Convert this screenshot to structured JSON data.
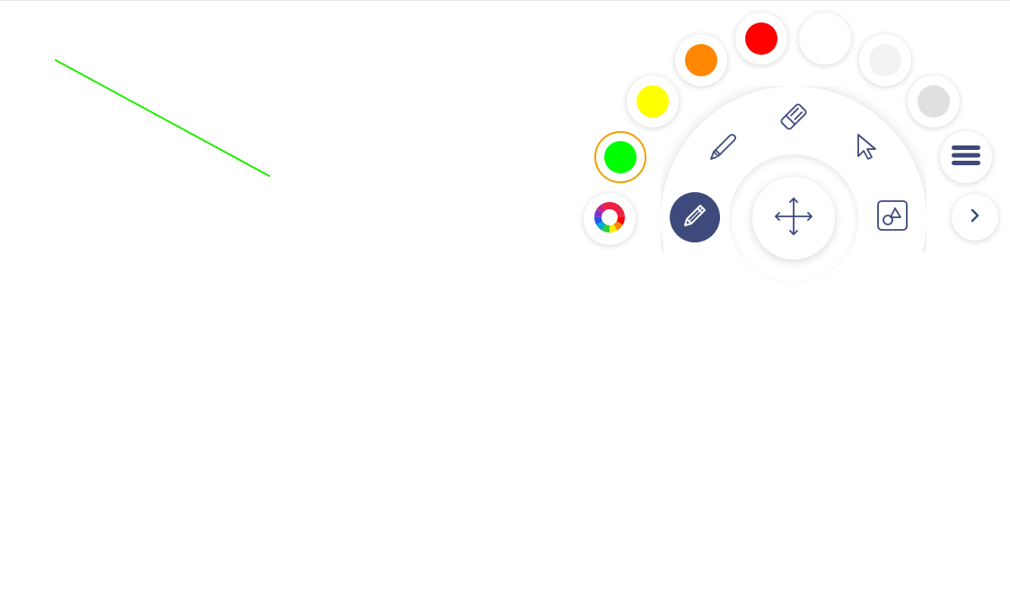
{
  "canvas": {
    "strokes": [
      {
        "color": "#22ee00",
        "points": [
          [
            62,
            67
          ],
          [
            300,
            196
          ]
        ]
      }
    ]
  },
  "toolbar": {
    "accent_color": "#3d4a7b",
    "selected_ring_color": "#f0a000",
    "palette": [
      {
        "name": "color-green",
        "color": "#00ff00",
        "selected": true
      },
      {
        "name": "color-yellow",
        "color": "#ffff00",
        "selected": false
      },
      {
        "name": "color-orange",
        "color": "#ff8800",
        "selected": false
      },
      {
        "name": "color-red",
        "color": "#ff0000",
        "selected": false
      },
      {
        "name": "color-white",
        "color": "#ffffff",
        "selected": false
      },
      {
        "name": "color-light-gray",
        "color": "#f2f2f2",
        "selected": false
      },
      {
        "name": "color-gray",
        "color": "#e0e0e0",
        "selected": false
      }
    ],
    "tools": [
      {
        "name": "pen-tool",
        "icon": "pencil-icon",
        "active": true
      },
      {
        "name": "highlighter-tool",
        "icon": "highlighter-icon",
        "active": false
      },
      {
        "name": "eraser-tool",
        "icon": "eraser-icon",
        "active": false
      },
      {
        "name": "select-tool",
        "icon": "pointer-icon",
        "active": false
      },
      {
        "name": "shapes-tool",
        "icon": "shapes-icon",
        "active": false
      },
      {
        "name": "move-tool",
        "icon": "move-icon",
        "active": false
      }
    ],
    "extra_buttons": [
      {
        "name": "color-wheel-button",
        "icon": "color-wheel-icon"
      },
      {
        "name": "menu-button",
        "icon": "hamburger-icon"
      },
      {
        "name": "expand-button",
        "icon": "chevron-right-icon"
      }
    ]
  }
}
